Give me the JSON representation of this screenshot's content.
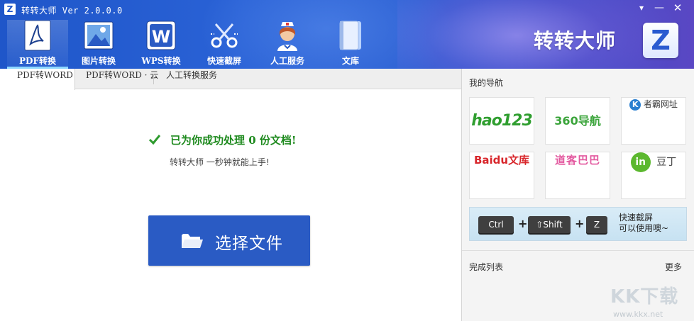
{
  "window": {
    "logo_letter": "Z",
    "title": "转转大师 Ver 2.0.0.0",
    "controls": {
      "settings": "▾",
      "minimize": "—",
      "close": "✕"
    }
  },
  "toolbar": {
    "items": [
      {
        "label": "PDF转换",
        "icon": "pdf-icon",
        "active": true
      },
      {
        "label": "图片转换",
        "icon": "image-icon",
        "active": false
      },
      {
        "label": "WPS转换",
        "icon": "wps-icon",
        "active": false
      },
      {
        "label": "快速截屏",
        "icon": "scissors-icon",
        "active": false
      },
      {
        "label": "人工服务",
        "icon": "nurse-icon",
        "active": false
      },
      {
        "label": "文库",
        "icon": "book-icon",
        "active": false
      }
    ]
  },
  "brand": {
    "name": "转转大师",
    "logo_letter": "Z"
  },
  "subtabs": [
    {
      "label": "PDF转WORD",
      "active": true
    },
    {
      "label": "PDF转WORD · 云",
      "active": false
    },
    {
      "label": "人工转换服务",
      "active": false
    }
  ],
  "main": {
    "status_text": "已为你成功处理 0 份文档!",
    "processed_count": 0,
    "subtitle": "转转大师 一秒钟就能上手!",
    "select_button": "选择文件"
  },
  "nav": {
    "title": "我的导航",
    "sites": [
      {
        "name": "hao123"
      },
      {
        "name": "360导航"
      },
      {
        "name": "者霸网址"
      },
      {
        "name": "Baidu文库"
      },
      {
        "name": "道客巴巴"
      },
      {
        "name": "豆丁"
      }
    ],
    "shortcut": {
      "keys": [
        "Ctrl",
        "⇧Shift",
        "Z"
      ],
      "plus": "+",
      "line1": "快速截屏",
      "line2": "可以使用噢~"
    }
  },
  "completed": {
    "title": "完成列表",
    "more": "更多"
  },
  "watermark": {
    "big": "KK下载",
    "small": "www.kkx.net"
  },
  "colors": {
    "header": "#1f56c9",
    "accent_button": "#2a5bc4",
    "success": "#1e8a1e"
  }
}
